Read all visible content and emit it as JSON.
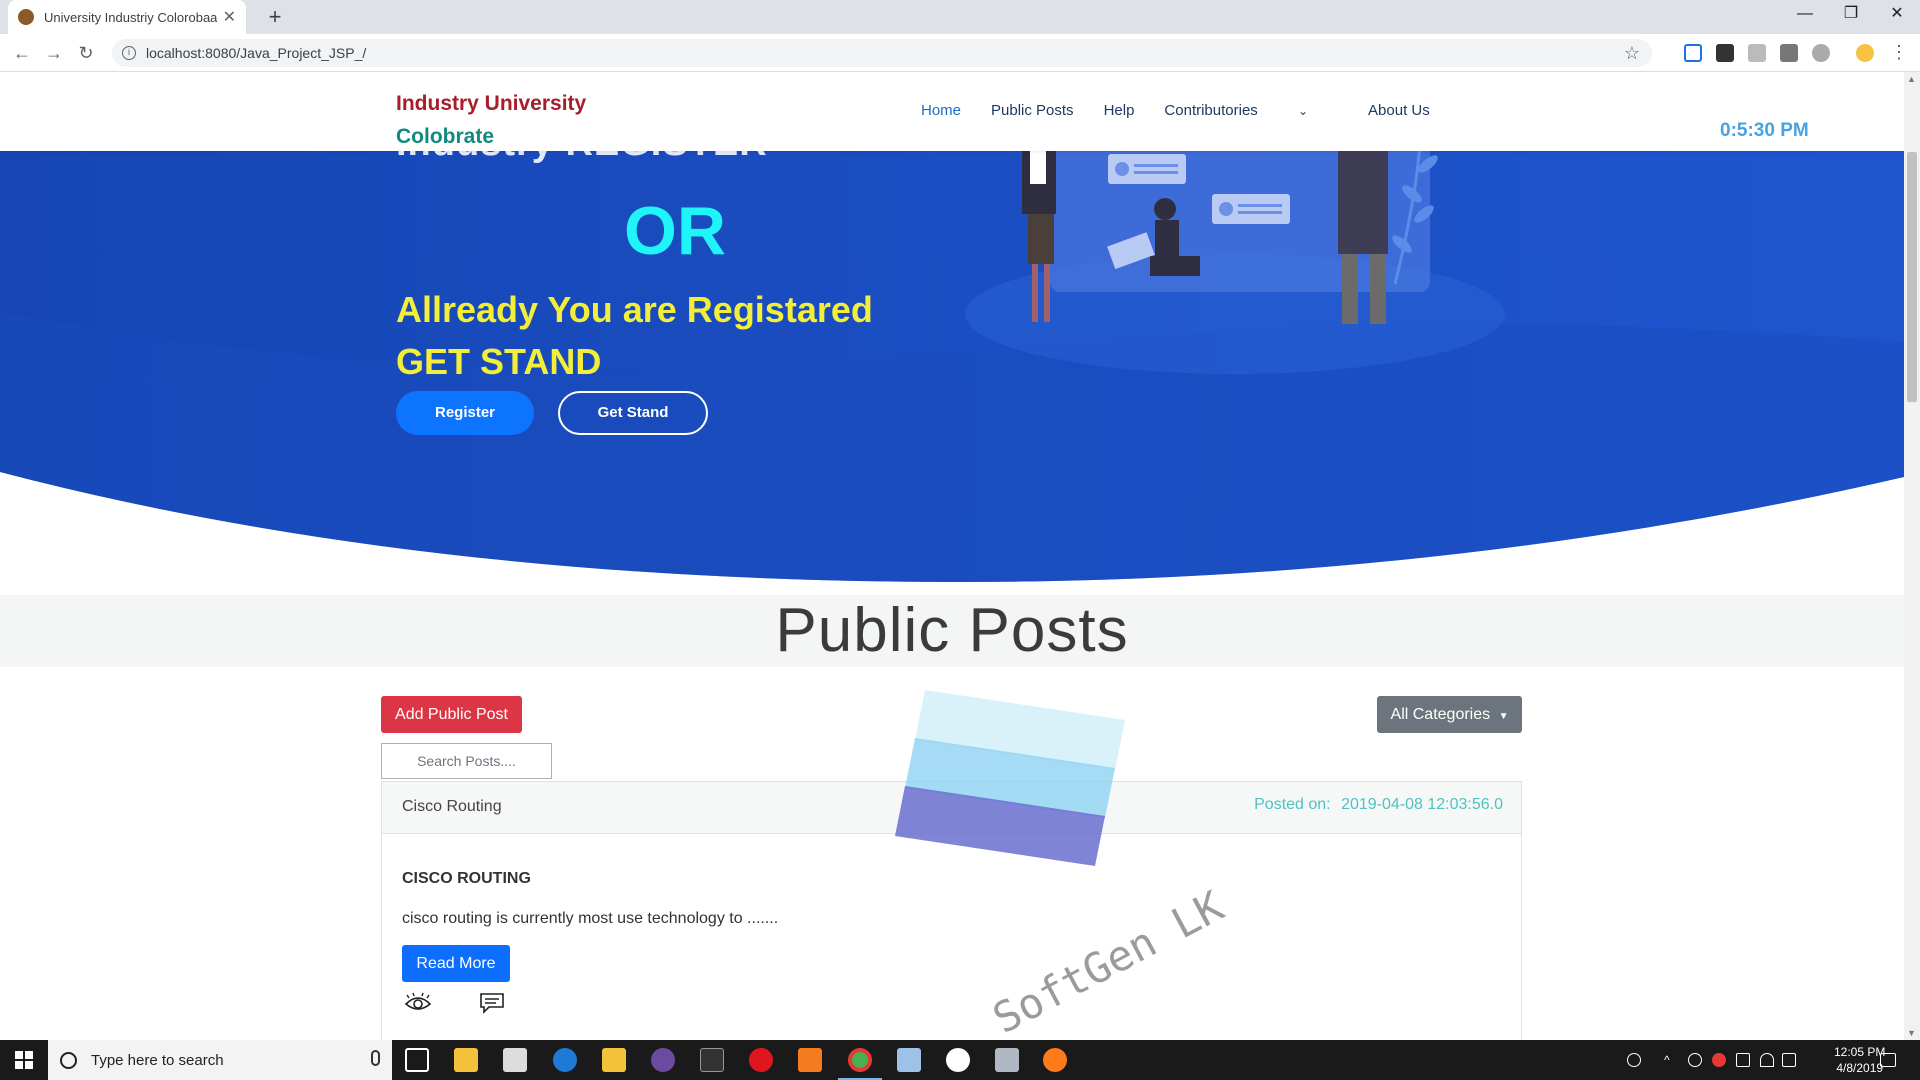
{
  "browser": {
    "tab_title": "University Industriy Colorobaarat",
    "tab_close": "✕",
    "new_tab": "+",
    "url": "localhost:8080/Java_Project_JSP_/",
    "info_glyph": "i",
    "star_glyph": "☆",
    "window": {
      "minimize": "—",
      "restore": "❐",
      "close": "✕"
    }
  },
  "nav": {
    "brand_line1": "Industry University",
    "brand_line2": "Colobrate",
    "links": [
      "Home",
      "Public Posts",
      "Help",
      "Contributories",
      "About Us"
    ],
    "dropdown_glyph": "⌄",
    "clock": "0:5:30 PM"
  },
  "hero": {
    "partial_heading": "Industry REGISTER",
    "or_text": "OR",
    "already_text": "Allready You are Registared GET STAND",
    "register_button": "Register",
    "get_stand_button": "Get Stand",
    "colors": {
      "background": "#1a4fc4",
      "accent_cyan": "#1ff5f9",
      "accent_yellow": "#f2ee3a"
    }
  },
  "public_posts": {
    "title": "Public Posts",
    "add_button": "Add Public Post",
    "categories_button": "All Categories",
    "search_placeholder": "Search Posts....",
    "post": {
      "topic": "Cisco Routing",
      "posted_label": "Posted on:",
      "posted_date": "2019-04-08 12:03:56.0",
      "title": "CISCO ROUTING",
      "excerpt": "cisco routing is currently most use technology to .......",
      "read_more": "Read More"
    }
  },
  "watermark": {
    "text": "SoftGen LK"
  },
  "taskbar": {
    "search_placeholder": "Type here to search",
    "time": "12:05 PM",
    "date": "4/8/2019"
  }
}
